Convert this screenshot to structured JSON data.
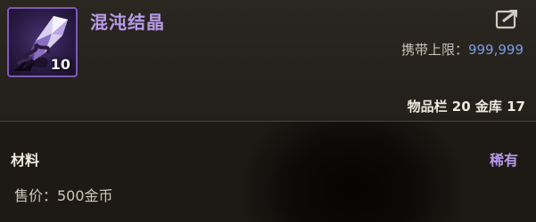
{
  "item": {
    "name": "混沌结晶",
    "stack_count": "10",
    "icon": "crystal-icon",
    "name_color": "#b79ae8"
  },
  "carry_limit": {
    "label": "携带上限：",
    "value": "999,999"
  },
  "storage": {
    "text": "物品栏 20 金库 17"
  },
  "details": {
    "category": "材料",
    "rarity": "稀有",
    "price": "售价：500金币"
  },
  "icons": {
    "share": "share-icon"
  }
}
